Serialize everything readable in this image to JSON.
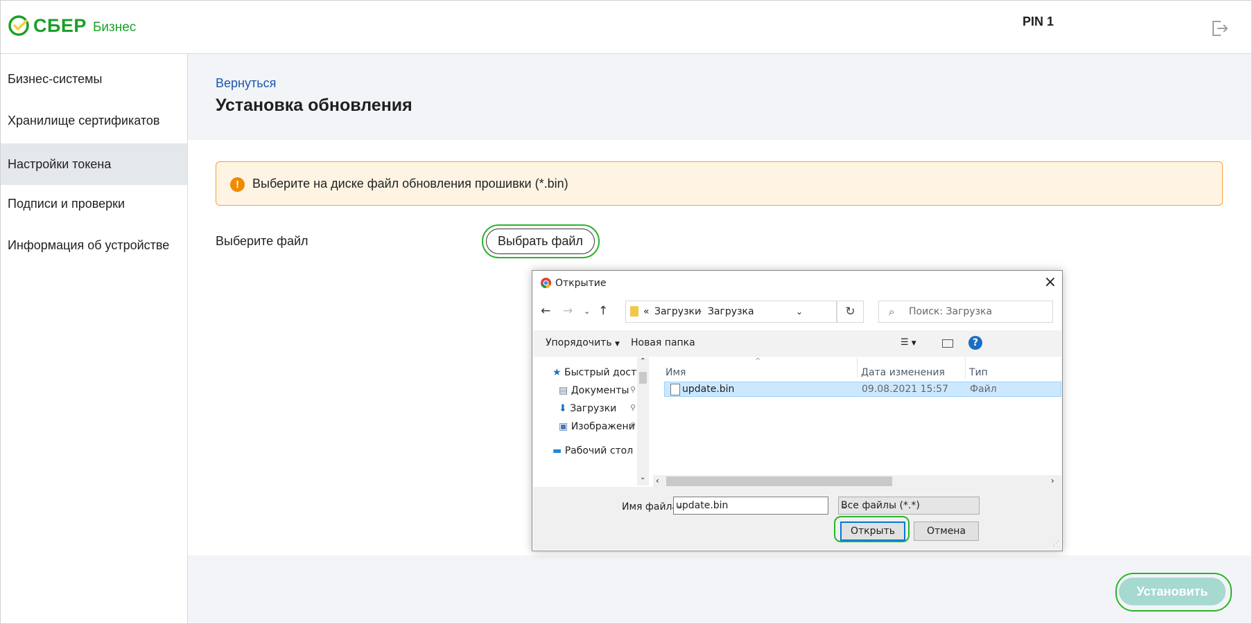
{
  "header": {
    "logo_text": "СБЕР",
    "logo_sub": "Бизнес",
    "pin_label": "PIN 1"
  },
  "sidebar": {
    "items": [
      {
        "label": "Бизнес-системы",
        "active": false
      },
      {
        "label": "Хранилище сертификатов",
        "active": false
      },
      {
        "label": "Настройки токена",
        "active": true
      },
      {
        "label": "Подписи и проверки",
        "active": false
      },
      {
        "label": "Информация об устройстве",
        "active": false
      }
    ]
  },
  "main": {
    "back_link": "Вернуться",
    "title": "Установка обновления",
    "alert_text": "Выберите на диске файл обновления прошивки (*.bin)",
    "file_label": "Выберите файл",
    "choose_button": "Выбрать файл",
    "install_button": "Установить"
  },
  "dialog": {
    "title": "Открытие",
    "breadcrumb": [
      "«",
      "Загрузки",
      "Загрузка"
    ],
    "search_placeholder": "Поиск: Загрузка",
    "toolbar": {
      "organize": "Упорядочить",
      "new_folder": "Новая папка"
    },
    "tree": [
      {
        "label": "Быстрый доступ",
        "icon": "star-icon"
      },
      {
        "label": "Документы",
        "icon": "document-icon"
      },
      {
        "label": "Загрузки",
        "icon": "download-icon"
      },
      {
        "label": "Изображени",
        "icon": "image-icon"
      },
      {
        "label": "Рабочий стол",
        "icon": "desktop-icon"
      }
    ],
    "columns": [
      "Имя",
      "Дата изменения",
      "Тип"
    ],
    "files": [
      {
        "name": "update.bin",
        "modified": "09.08.2021 15:57",
        "type": "Файл"
      }
    ],
    "filename_label": "Имя файла:",
    "filename_value": "update.bin",
    "filetype_value": "Все файлы (*.*)",
    "open_button": "Открыть",
    "cancel_button": "Отмена"
  }
}
